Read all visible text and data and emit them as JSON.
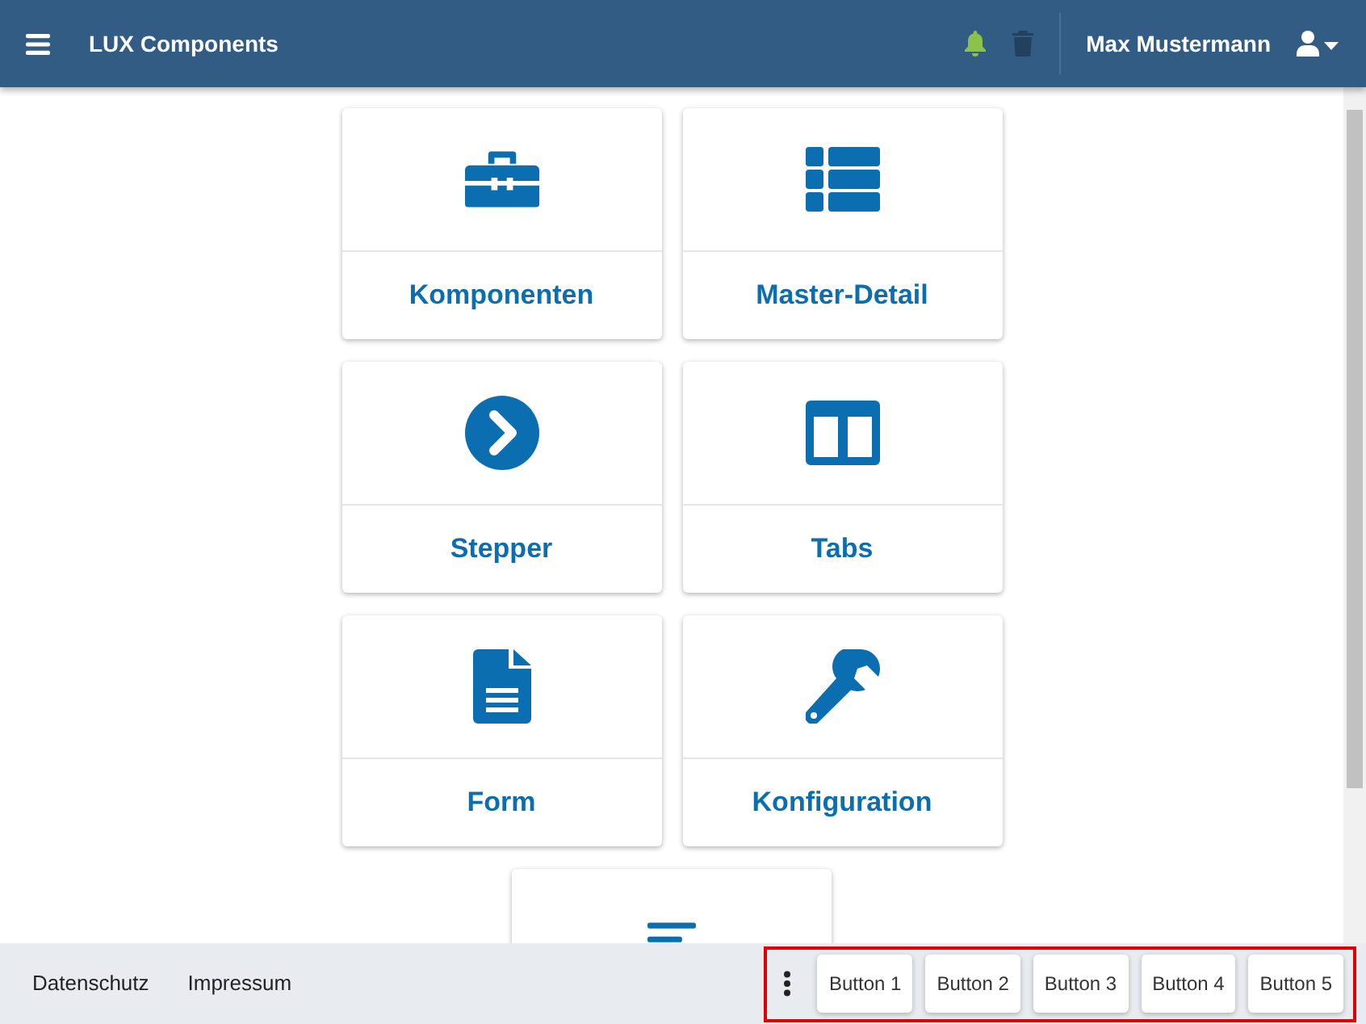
{
  "header": {
    "title": "LUX Components",
    "user": "Max Mustermann"
  },
  "cards": [
    {
      "kind": "toolbox",
      "label": "Komponenten"
    },
    {
      "kind": "table",
      "label": "Master-Detail"
    },
    {
      "kind": "chevron",
      "label": "Stepper"
    },
    {
      "kind": "columns",
      "label": "Tabs"
    },
    {
      "kind": "document",
      "label": "Form"
    },
    {
      "kind": "wrench",
      "label": "Konfiguration"
    },
    {
      "kind": "lines"
    }
  ],
  "footer": {
    "links": [
      "Datenschutz",
      "Impressum"
    ],
    "buttons": [
      "Button 1",
      "Button 2",
      "Button 3",
      "Button 4",
      "Button 5"
    ]
  }
}
